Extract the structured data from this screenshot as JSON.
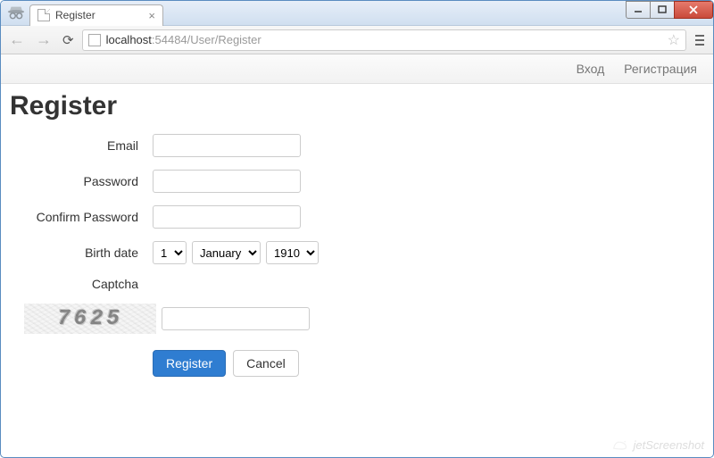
{
  "browser": {
    "tab_title": "Register",
    "url_host": "localhost",
    "url_port_path": ":54484/User/Register"
  },
  "nav": {
    "login": "Вход",
    "register": "Регистрация"
  },
  "page": {
    "heading": "Register"
  },
  "form": {
    "email_label": "Email",
    "email_value": "",
    "password_label": "Password",
    "password_value": "",
    "confirm_label": "Confirm Password",
    "confirm_value": "",
    "birth_label": "Birth date",
    "birth_day": "1",
    "birth_month": "January",
    "birth_year": "1910",
    "captcha_label": "Captcha",
    "captcha_image_text": "7625",
    "captcha_value": "",
    "submit_label": "Register",
    "cancel_label": "Cancel"
  },
  "watermark": "jetScreenshot"
}
